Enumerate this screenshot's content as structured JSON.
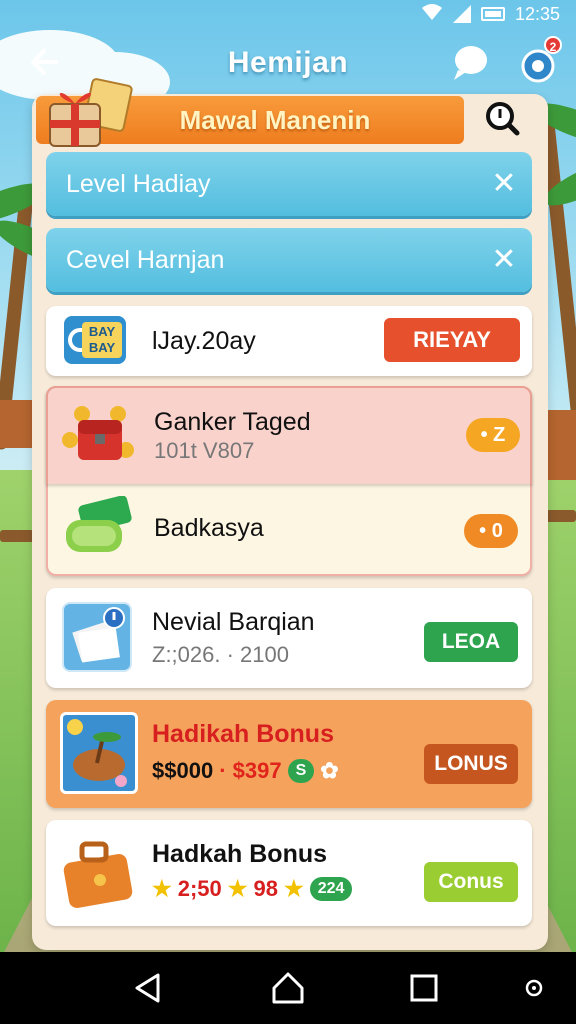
{
  "status_bar": {
    "time": "12:35"
  },
  "app_bar": {
    "title": "Hemijan",
    "notification_count": "2"
  },
  "banner": {
    "title": "Mawal Manenin"
  },
  "blue_rows": [
    {
      "label": "Level Hadiay"
    },
    {
      "label": "Cevel Harnjan"
    }
  ],
  "cards": [
    {
      "icon_text_top": "BAY",
      "icon_text_bottom": "BAY",
      "title": "lJay.20ay",
      "button": "RIEYAY"
    },
    {
      "title": "Ganker Taged",
      "subtitle": "101t V807",
      "pill": "• Z"
    },
    {
      "title": "Badkasya",
      "pill": "• 0"
    },
    {
      "title": "Nevial Barqian",
      "subtitle": "Z:;026. · 2100",
      "button": "LEOA"
    },
    {
      "title": "Hadikah Bonus",
      "amount_1": "$$000",
      "amount_2": "· $397",
      "chip": "S",
      "button": "LONUS"
    },
    {
      "title": "Hadkah  Bonus",
      "amount_1": "2;50",
      "amount_2": "98",
      "chip": "224",
      "button": "Conus"
    }
  ],
  "colors": {
    "accent_blue": "#53bedf",
    "banner_orange": "#ee7d1f",
    "red_button": "#e6502c",
    "green_button": "#2ea44f",
    "lime_button": "#9acd32",
    "bonus_card": "#f5a25c",
    "bonus_button": "#c6561f"
  },
  "icons": {
    "back": "arrow-left-icon",
    "chat": "chat-bubble-icon",
    "settings": "gear-icon",
    "search": "search-icon",
    "close": "close-icon"
  }
}
